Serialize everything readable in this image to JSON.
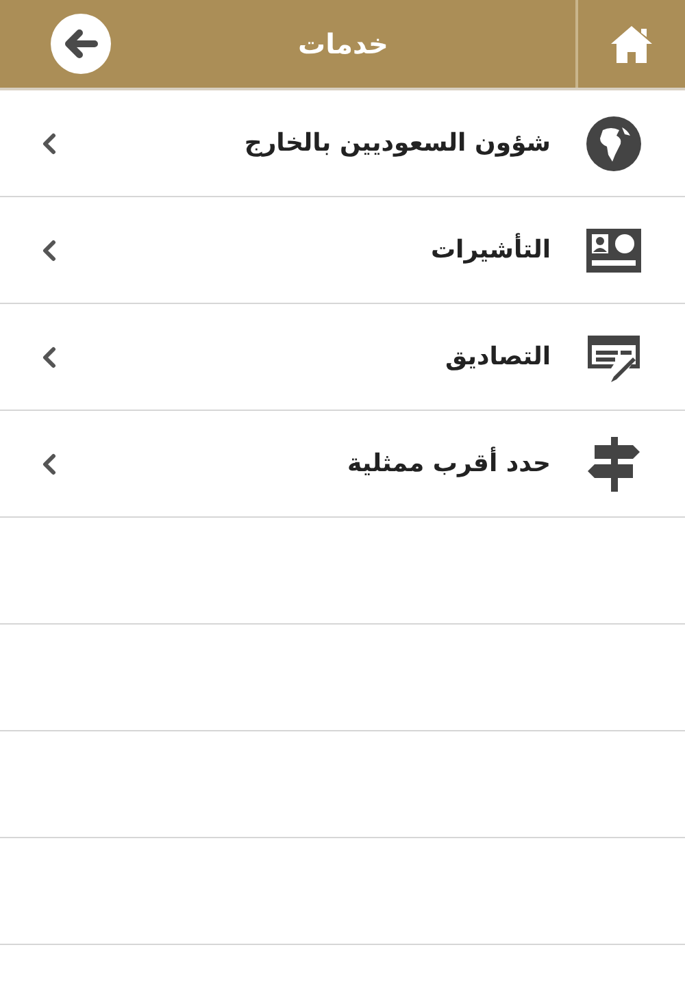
{
  "header": {
    "title": "خدمات"
  },
  "items": [
    {
      "label": "شؤون السعوديين بالخارج",
      "kind": "globe"
    },
    {
      "label": "التأشيرات",
      "kind": "visa"
    },
    {
      "label": "التصاديق",
      "kind": "document"
    },
    {
      "label": "حدد أقرب ممثلية",
      "kind": "signpost"
    }
  ]
}
